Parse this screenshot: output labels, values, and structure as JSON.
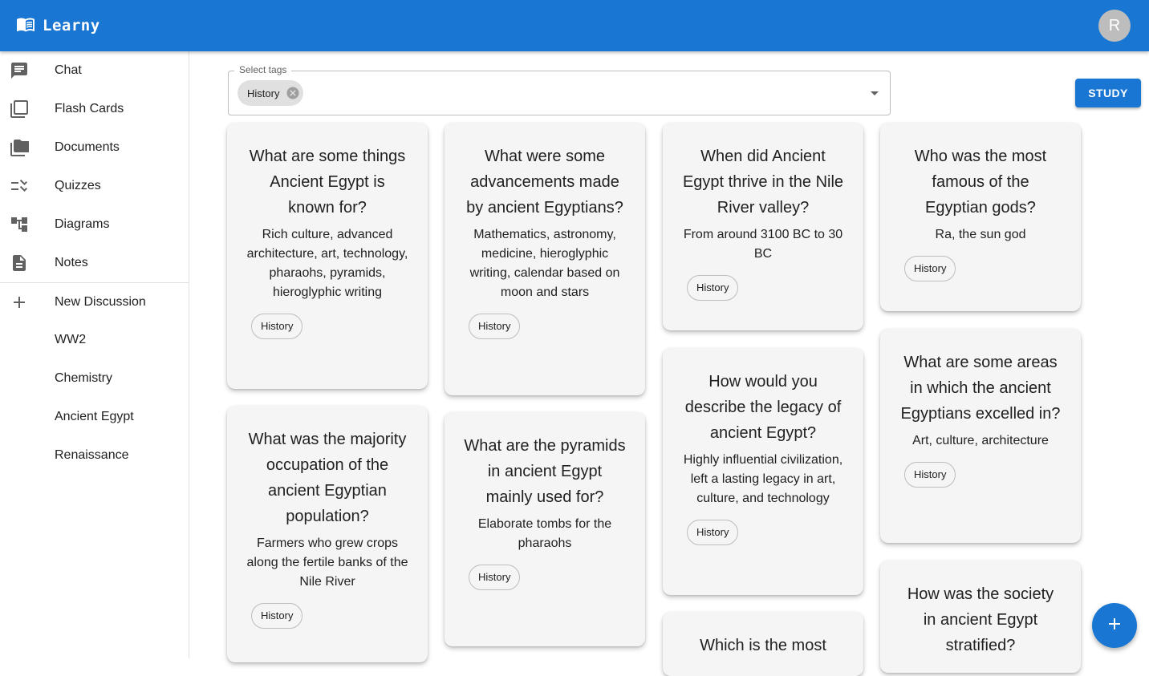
{
  "app": {
    "title": "Learny",
    "logo_icon": "book-open-icon",
    "avatar_initial": "R"
  },
  "colors": {
    "primary": "#1976d2",
    "card_bg": "#f5f5f5",
    "sidebar_divider": "#e0e0e0"
  },
  "sidebar": {
    "nav": [
      {
        "label": "Chat",
        "icon": "chat-icon"
      },
      {
        "label": "Flash Cards",
        "icon": "flash-cards-icon"
      },
      {
        "label": "Documents",
        "icon": "documents-icon"
      },
      {
        "label": "Quizzes",
        "icon": "quizzes-icon"
      },
      {
        "label": "Diagrams",
        "icon": "diagrams-icon"
      },
      {
        "label": "Notes",
        "icon": "notes-icon"
      }
    ],
    "new_discussion": {
      "label": "New Discussion",
      "icon": "plus-icon"
    },
    "discussions": [
      "WW2",
      "Chemistry",
      "Ancient Egypt",
      "Renaissance"
    ]
  },
  "tag_selector": {
    "label": "Select tags",
    "selected": [
      "History"
    ]
  },
  "study_button": "STUDY",
  "cards": [
    {
      "question": "What are some things Ancient Egypt is known for?",
      "answer": "Rich culture, advanced architecture, art, technology, pharaohs, pyramids, hieroglyphic writing",
      "tag": "History"
    },
    {
      "question": "What were some advancements made by ancient Egyptians?",
      "answer": "Mathematics, astronomy, medicine, hieroglyphic writing, calendar based on moon and stars",
      "tag": "History"
    },
    {
      "question": "When did Ancient Egypt thrive in the Nile River valley?",
      "answer": "From around 3100 BC to 30 BC",
      "tag": "History"
    },
    {
      "question": "Who was the most famous of the Egyptian gods?",
      "answer": "Ra, the sun god",
      "tag": "History"
    },
    {
      "question": "What was the majority occupation of the ancient Egyptian population?",
      "answer": "Farmers who grew crops along the fertile banks of the Nile River",
      "tag": "History"
    },
    {
      "question": "What are the pyramids in ancient Egypt mainly used for?",
      "answer": "Elaborate tombs for the pharaohs",
      "tag": "History"
    },
    {
      "question": "How would you describe the legacy of ancient Egypt?",
      "answer": "Highly influential civilization, left a lasting legacy in art, culture, and technology",
      "tag": "History"
    },
    {
      "question": "What are some areas in which the ancient Egyptians excelled in?",
      "answer": "Art, culture, architecture",
      "tag": "History"
    },
    {
      "question": "Which is the most",
      "answer": "",
      "tag": ""
    },
    {
      "question": "How was the society in ancient Egypt stratified?",
      "answer": "",
      "tag": ""
    }
  ],
  "fab_icon": "plus-icon"
}
